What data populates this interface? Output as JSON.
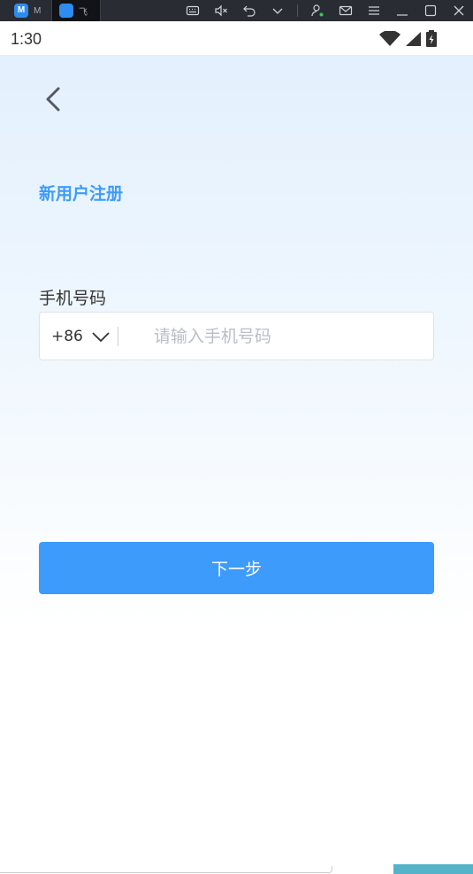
{
  "emulator": {
    "tabs": [
      {
        "label": "M",
        "icon": "app-m-icon"
      },
      {
        "label": "飞",
        "icon": "app-fly-icon"
      }
    ],
    "tools": [
      "keyboard-icon",
      "mute-icon",
      "undo-icon",
      "chevron-down-icon",
      "account-icon",
      "mail-icon",
      "menu-icon",
      "minimize-icon",
      "maximize-icon",
      "close-icon"
    ]
  },
  "status_bar": {
    "time": "1:30"
  },
  "page": {
    "title": "新用户注册",
    "phone_label": "手机号码",
    "country_code": "+86",
    "phone_placeholder": "请输入手机号码",
    "phone_value": "",
    "next_button": "下一步"
  },
  "colors": {
    "accent": "#3d9bfb",
    "text": "#333333",
    "placeholder": "#b9bec6"
  }
}
